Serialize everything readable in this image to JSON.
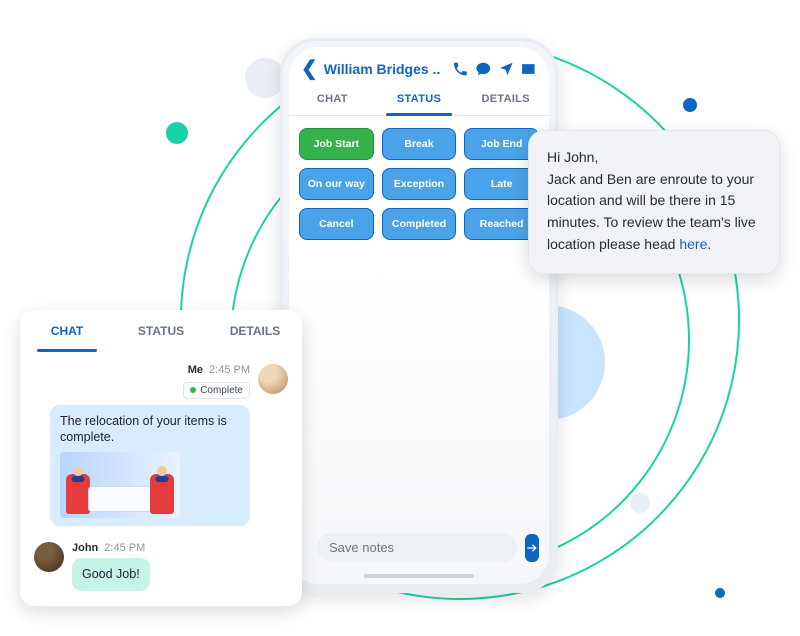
{
  "phone": {
    "header": {
      "title": "William Bridges .."
    },
    "tabs": {
      "chat": "CHAT",
      "status": "STATUS",
      "details": "DETAILS"
    },
    "status_buttons": {
      "job_start": "Job Start",
      "break": "Break",
      "job_end": "Job End",
      "on_our_way": "On our way",
      "exception": "Exception",
      "late": "Late",
      "cancel": "Cancel",
      "completed": "Completed",
      "reached": "Reached"
    },
    "composer": {
      "placeholder": "Save notes"
    }
  },
  "chat_card": {
    "tabs": {
      "chat": "CHAT",
      "status": "STATUS",
      "details": "DETAILS"
    },
    "msg1": {
      "sender": "Me",
      "time": "2:45 PM",
      "badge": "Complete",
      "text": "The relocation of your items is complete."
    },
    "msg2": {
      "sender": "John",
      "time": "2:45 PM",
      "text": "Good Job!"
    }
  },
  "popup": {
    "greeting": "Hi John,",
    "body1": "Jack and Ben are enroute to your location and will be there in 15 minutes. To review the team's live location please head ",
    "link": "here",
    "body2": "."
  }
}
